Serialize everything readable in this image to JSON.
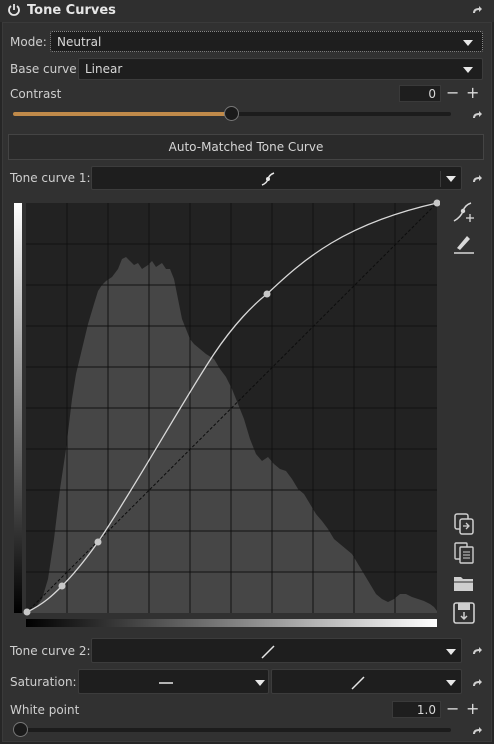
{
  "module": {
    "title": "Tone Curves",
    "icons": {
      "power": "power-icon",
      "reset": "reset-arrow-icon"
    }
  },
  "mode": {
    "label": "Mode:",
    "value": "Neutral"
  },
  "base_curve": {
    "label": "Base curve:",
    "value": "Linear"
  },
  "contrast": {
    "label": "Contrast",
    "value": "0",
    "slider_fraction": 0.5
  },
  "auto_button": {
    "label": "Auto-Matched Tone Curve"
  },
  "tone_curve_1": {
    "label": "Tone curve 1:"
  },
  "tone_curve_2": {
    "label": "Tone curve 2:"
  },
  "saturation": {
    "label": "Saturation:"
  },
  "white_point": {
    "label": "White point",
    "value": "1.0",
    "slider_fraction": 0.0
  },
  "side_icons": [
    "edit-points-icon",
    "freehand-draw-icon",
    "copy-icon",
    "paste-icon",
    "open-folder-icon",
    "save-icon"
  ],
  "curve_points": [
    [
      0.0,
      0.0
    ],
    [
      0.08,
      0.07
    ],
    [
      0.17,
      0.17
    ],
    [
      0.58,
      0.78
    ],
    [
      1.0,
      1.0
    ]
  ],
  "colors": {
    "accent": "#c08a4a",
    "panel": "#313131",
    "graph_bg": "#222222",
    "histogram": "#464646"
  }
}
